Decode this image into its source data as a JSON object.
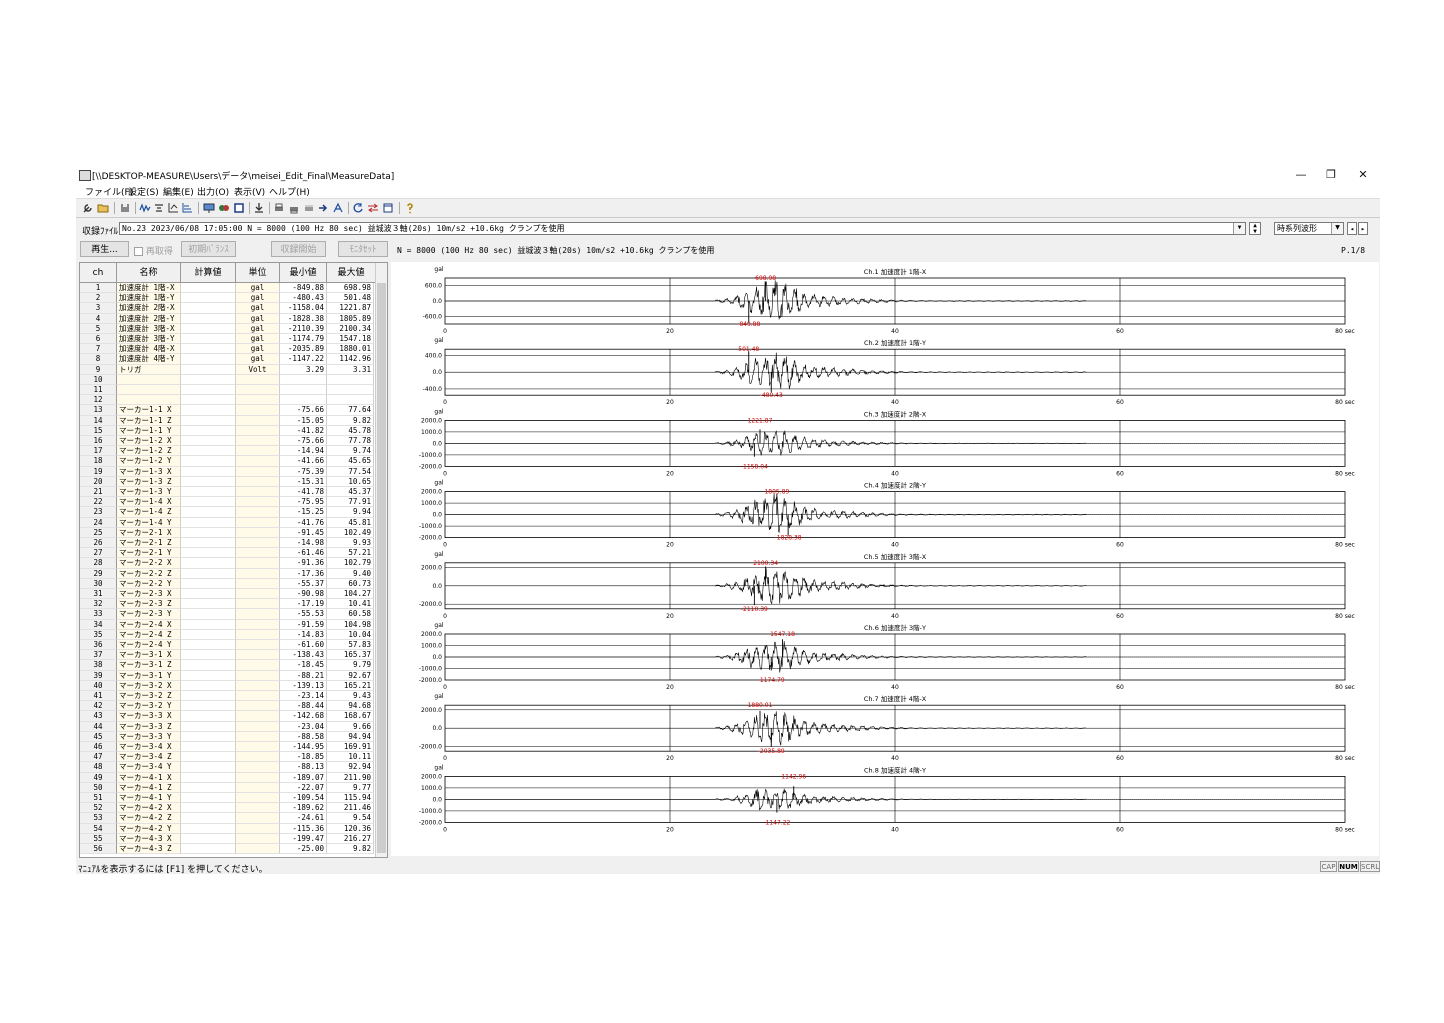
{
  "window": {
    "title": "[\\\\DESKTOP-MEASURE\\Users\\データ\\meisei_Edit_Final\\MeasureData]",
    "min_label": "—",
    "restore_label": "❐",
    "close_label": "✕"
  },
  "menu": [
    {
      "label": "ファイル(F)"
    },
    {
      "label": "設定(S)"
    },
    {
      "label": "編集(E)"
    },
    {
      "label": "出力(O)"
    },
    {
      "label": "表示(V)"
    },
    {
      "label": "ヘルプ(H)"
    }
  ],
  "filebar": {
    "label": "収録ﾌｧｲﾙ",
    "value": "No.23   2023/06/08 17:05:00 N = 8000 (100 Hz 80 sec) 益城波３軸(20s) 10m/s2 +10.6kg クランプを使用",
    "mode_value": "時系列波形"
  },
  "controls": {
    "play": "再生...",
    "rerecord": "再取得",
    "init_balance": "初期ﾊﾞﾗﾝｽ",
    "start_record": "収録開始",
    "monitor_reset": "ﾓﾆﾀｾｯﾄ",
    "info": "N = 8000 (100 Hz 80 sec) 益城波３軸(20s) 10m/s2 +10.6kg クランプを使用",
    "page": "P.1/8"
  },
  "table": {
    "headers": {
      "ch": "ch",
      "name": "名称",
      "calc": "計算値",
      "unit": "単位",
      "min": "最小値",
      "max": "最大値"
    },
    "rows": [
      {
        "ch": "1",
        "name": "加速度計 1階-X",
        "unit": "gal",
        "min": "-849.88",
        "max": "698.98"
      },
      {
        "ch": "2",
        "name": "加速度計 1階-Y",
        "unit": "gal",
        "min": "-480.43",
        "max": "501.48"
      },
      {
        "ch": "3",
        "name": "加速度計 2階-X",
        "unit": "gal",
        "min": "-1158.04",
        "max": "1221.87"
      },
      {
        "ch": "4",
        "name": "加速度計 2階-Y",
        "unit": "gal",
        "min": "-1828.38",
        "max": "1805.89"
      },
      {
        "ch": "5",
        "name": "加速度計 3階-X",
        "unit": "gal",
        "min": "-2110.39",
        "max": "2100.34"
      },
      {
        "ch": "6",
        "name": "加速度計 3階-Y",
        "unit": "gal",
        "min": "-1174.79",
        "max": "1547.18"
      },
      {
        "ch": "7",
        "name": "加速度計 4階-X",
        "unit": "gal",
        "min": "-2035.89",
        "max": "1880.01"
      },
      {
        "ch": "8",
        "name": "加速度計 4階-Y",
        "unit": "gal",
        "min": "-1147.22",
        "max": "1142.96"
      },
      {
        "ch": "9",
        "name": "   トリガ",
        "unit": "Volt",
        "min": "3.29",
        "max": "3.31"
      },
      {
        "ch": "10",
        "name": "",
        "unit": "",
        "min": "",
        "max": ""
      },
      {
        "ch": "11",
        "name": "",
        "unit": "",
        "min": "",
        "max": ""
      },
      {
        "ch": "12",
        "name": "",
        "unit": "",
        "min": "",
        "max": ""
      },
      {
        "ch": "13",
        "name": "マーカー1-1  X",
        "unit": "",
        "min": "-75.66",
        "max": "77.64"
      },
      {
        "ch": "14",
        "name": "マーカー1-1  Z",
        "unit": "",
        "min": "-15.05",
        "max": "9.82"
      },
      {
        "ch": "15",
        "name": "マーカー1-1  Y",
        "unit": "",
        "min": "-41.82",
        "max": "45.78"
      },
      {
        "ch": "16",
        "name": "マーカー1-2  X",
        "unit": "",
        "min": "-75.66",
        "max": "77.78"
      },
      {
        "ch": "17",
        "name": "マーカー1-2  Z",
        "unit": "",
        "min": "-14.94",
        "max": "9.74"
      },
      {
        "ch": "18",
        "name": "マーカー1-2  Y",
        "unit": "",
        "min": "-41.66",
        "max": "45.65"
      },
      {
        "ch": "19",
        "name": "マーカー1-3  X",
        "unit": "",
        "min": "-75.39",
        "max": "77.54"
      },
      {
        "ch": "20",
        "name": "マーカー1-3  Z",
        "unit": "",
        "min": "-15.31",
        "max": "10.65"
      },
      {
        "ch": "21",
        "name": "マーカー1-3  Y",
        "unit": "",
        "min": "-41.78",
        "max": "45.37"
      },
      {
        "ch": "22",
        "name": "マーカー1-4  X",
        "unit": "",
        "min": "-75.95",
        "max": "77.91"
      },
      {
        "ch": "23",
        "name": "マーカー1-4  Z",
        "unit": "",
        "min": "-15.25",
        "max": "9.94"
      },
      {
        "ch": "24",
        "name": "マーカー1-4  Y",
        "unit": "",
        "min": "-41.76",
        "max": "45.81"
      },
      {
        "ch": "25",
        "name": "マーカー2-1  X",
        "unit": "",
        "min": "-91.45",
        "max": "102.49"
      },
      {
        "ch": "26",
        "name": "マーカー2-1  Z",
        "unit": "",
        "min": "-14.98",
        "max": "9.93"
      },
      {
        "ch": "27",
        "name": "マーカー2-1  Y",
        "unit": "",
        "min": "-61.46",
        "max": "57.21"
      },
      {
        "ch": "28",
        "name": "マーカー2-2  X",
        "unit": "",
        "min": "-91.36",
        "max": "102.79"
      },
      {
        "ch": "29",
        "name": "マーカー2-2  Z",
        "unit": "",
        "min": "-17.36",
        "max": "9.40"
      },
      {
        "ch": "30",
        "name": "マーカー2-2  Y",
        "unit": "",
        "min": "-55.37",
        "max": "60.73"
      },
      {
        "ch": "31",
        "name": "マーカー2-3  X",
        "unit": "",
        "min": "-90.98",
        "max": "104.27"
      },
      {
        "ch": "32",
        "name": "マーカー2-3  Z",
        "unit": "",
        "min": "-17.19",
        "max": "10.41"
      },
      {
        "ch": "33",
        "name": "マーカー2-3  Y",
        "unit": "",
        "min": "-55.53",
        "max": "60.58"
      },
      {
        "ch": "34",
        "name": "マーカー2-4  X",
        "unit": "",
        "min": "-91.59",
        "max": "104.98"
      },
      {
        "ch": "35",
        "name": "マーカー2-4  Z",
        "unit": "",
        "min": "-14.83",
        "max": "10.04"
      },
      {
        "ch": "36",
        "name": "マーカー2-4  Y",
        "unit": "",
        "min": "-61.60",
        "max": "57.83"
      },
      {
        "ch": "37",
        "name": "マーカー3-1  X",
        "unit": "",
        "min": "-138.43",
        "max": "165.37"
      },
      {
        "ch": "38",
        "name": "マーカー3-1  Z",
        "unit": "",
        "min": "-18.45",
        "max": "9.79"
      },
      {
        "ch": "39",
        "name": "マーカー3-1  Y",
        "unit": "",
        "min": "-88.21",
        "max": "92.67"
      },
      {
        "ch": "40",
        "name": "マーカー3-2  X",
        "unit": "",
        "min": "-139.13",
        "max": "165.21"
      },
      {
        "ch": "41",
        "name": "マーカー3-2  Z",
        "unit": "",
        "min": "-23.14",
        "max": "9.43"
      },
      {
        "ch": "42",
        "name": "マーカー3-2  Y",
        "unit": "",
        "min": "-88.44",
        "max": "94.68"
      },
      {
        "ch": "43",
        "name": "マーカー3-3  X",
        "unit": "",
        "min": "-142.68",
        "max": "168.67"
      },
      {
        "ch": "44",
        "name": "マーカー3-3  Z",
        "unit": "",
        "min": "-23.04",
        "max": "9.66"
      },
      {
        "ch": "45",
        "name": "マーカー3-3  Y",
        "unit": "",
        "min": "-88.58",
        "max": "94.94"
      },
      {
        "ch": "46",
        "name": "マーカー3-4  X",
        "unit": "",
        "min": "-144.95",
        "max": "169.91"
      },
      {
        "ch": "47",
        "name": "マーカー3-4  Z",
        "unit": "",
        "min": "-18.85",
        "max": "10.11"
      },
      {
        "ch": "48",
        "name": "マーカー3-4  Y",
        "unit": "",
        "min": "-88.13",
        "max": "92.94"
      },
      {
        "ch": "49",
        "name": "マーカー4-1  X",
        "unit": "",
        "min": "-189.07",
        "max": "211.90"
      },
      {
        "ch": "50",
        "name": "マーカー4-1  Z",
        "unit": "",
        "min": "-22.07",
        "max": "9.77"
      },
      {
        "ch": "51",
        "name": "マーカー4-1  Y",
        "unit": "",
        "min": "-109.54",
        "max": "115.94"
      },
      {
        "ch": "52",
        "name": "マーカー4-2  X",
        "unit": "",
        "min": "-189.62",
        "max": "211.46"
      },
      {
        "ch": "53",
        "name": "マーカー4-2  Z",
        "unit": "",
        "min": "-24.61",
        "max": "9.54"
      },
      {
        "ch": "54",
        "name": "マーカー4-2  Y",
        "unit": "",
        "min": "-115.36",
        "max": "120.36"
      },
      {
        "ch": "55",
        "name": "マーカー4-3  X",
        "unit": "",
        "min": "-199.47",
        "max": "216.27"
      },
      {
        "ch": "56",
        "name": "マーカー4-3  Z",
        "unit": "",
        "min": "-25.00",
        "max": "9.82"
      }
    ]
  },
  "chart_data": {
    "type": "line",
    "x_unit_label": "80 sec",
    "xlim": [
      0,
      80
    ],
    "x_ticks": [
      "0",
      "20",
      "40",
      "60"
    ],
    "y_unit": "gal",
    "panels": [
      {
        "title": "Ch.1 加速度計 1階-X",
        "y_ticks": [
          "600.0",
          "0.0",
          "-600.0"
        ],
        "ylim": [
          -900,
          900
        ],
        "max_label": "698.98",
        "min_label": "-849.88",
        "max": 698.98,
        "min": -849.88,
        "t_max": 28.5,
        "t_min": 27.0
      },
      {
        "title": "Ch.2 加速度計 1階-Y",
        "y_ticks": [
          "400.0",
          "0.0",
          "-400.0"
        ],
        "ylim": [
          -550,
          550
        ],
        "max_label": "501.48",
        "min_label": "-480.43",
        "max": 501.48,
        "min": -480.43,
        "t_max": 27.0,
        "t_min": 29.0
      },
      {
        "title": "Ch.3 加速度計 2階-X",
        "y_ticks": [
          "2000.0",
          "1000.0",
          "0.0",
          "-1000.0",
          "-2000.0"
        ],
        "ylim": [
          -2000,
          2000
        ],
        "max_label": "1221.87",
        "min_label": "-1158.04",
        "max": 1221.87,
        "min": -1158.04,
        "t_max": 28.0,
        "t_min": 27.5
      },
      {
        "title": "Ch.4 加速度計 2階-Y",
        "y_ticks": [
          "2000.0",
          "1000.0",
          "0.0",
          "-1000.0",
          "-2000.0"
        ],
        "ylim": [
          -2000,
          2000
        ],
        "max_label": "1805.89",
        "min_label": "-1828.38",
        "max": 1805.89,
        "min": -1828.38,
        "t_max": 29.5,
        "t_min": 30.5
      },
      {
        "title": "Ch.5 加速度計 3階-X",
        "y_ticks": [
          "2000.0",
          "0.0",
          "-2000.0"
        ],
        "ylim": [
          -2500,
          2500
        ],
        "max_label": "2100.34",
        "min_label": "-2110.39",
        "max": 2100.34,
        "min": -2110.39,
        "t_max": 28.5,
        "t_min": 27.5
      },
      {
        "title": "Ch.6 加速度計 3階-Y",
        "y_ticks": [
          "2000.0",
          "1000.0",
          "0.0",
          "-1000.0",
          "-2000.0"
        ],
        "ylim": [
          -2000,
          2000
        ],
        "max_label": "1547.18",
        "min_label": "-1174.79",
        "max": 1547.18,
        "min": -1174.79,
        "t_max": 30.0,
        "t_min": 29.0
      },
      {
        "title": "Ch.7 加速度計 4階-X",
        "y_ticks": [
          "2000.0",
          "0.0",
          "-2000.0"
        ],
        "ylim": [
          -2500,
          2500
        ],
        "max_label": "1880.01",
        "min_label": "-2035.89",
        "max": 1880.01,
        "min": -2035.89,
        "t_max": 28.0,
        "t_min": 29.0
      },
      {
        "title": "Ch.8 加速度計 4階-Y",
        "y_ticks": [
          "2000.0",
          "1000.0",
          "0.0",
          "-1000.0",
          "-2000.0"
        ],
        "ylim": [
          -2000,
          2000
        ],
        "max_label": "1142.96",
        "min_label": "-1147.22",
        "max": 1142.96,
        "min": -1147.22,
        "t_max": 31.0,
        "t_min": 29.5
      }
    ]
  },
  "status": {
    "message": "ﾏﾆｭｱﾙを表示するには [F1] を押してください。",
    "cap": "CAP",
    "num": "NUM",
    "scrl": "SCRL"
  },
  "colors": {
    "trace": "#000000",
    "peak_label": "#d40000",
    "grid": "#000000"
  }
}
